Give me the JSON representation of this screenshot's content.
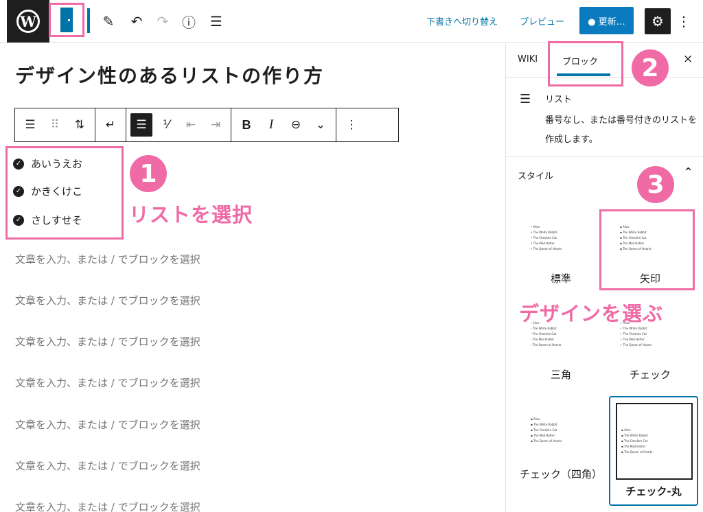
{
  "topbar": {
    "logo_glyph": "W",
    "icons": [
      "block-inserter-icon",
      "edit-pencil-icon",
      "undo-icon",
      "redo-icon",
      "info-icon",
      "list-view-icon"
    ],
    "switch_draft_label": "下書きへ切り替え",
    "preview_label": "プレビュー",
    "update_label": "● 更新…",
    "settings_glyph": "⚙",
    "more_glyph": "⋮"
  },
  "editor": {
    "title": "デザイン性のあるリストの作り方",
    "list_items": [
      "あいうえお",
      "かきくけこ",
      "さしすせそ"
    ],
    "paragraph_placeholder": "文章を入力、または / でブロックを選択",
    "paragraph_count": 7
  },
  "block_toolbar": {
    "glyphs": {
      "list_transform": "☰",
      "drag": "⠿",
      "mover": "⇅",
      "indent_back": "↵",
      "unordered": "☰",
      "ordered": "⅟",
      "outdent": "⇤",
      "indent": "⇥",
      "bold": "B",
      "italic": "I",
      "link": "⊖",
      "more_rich": "⌄",
      "options": "⋮"
    }
  },
  "annotations": {
    "step1": "1",
    "step1_text": "リストを選択",
    "step2": "2",
    "step3": "3",
    "step3_text": "デザインを選ぶ"
  },
  "sidebar": {
    "tab_wiki": "WIKI",
    "tab_block": "ブロック",
    "close_glyph": "×",
    "block_name": "リスト",
    "block_description": "番号なし、または番号付きのリストを作成します。",
    "styles_heading": "スタイル",
    "styles_chevron": "⌃",
    "styles": [
      {
        "label": "標準",
        "marker": "•"
      },
      {
        "label": "矢印",
        "marker": "▪"
      },
      {
        "label": "三角",
        "marker": "›"
      },
      {
        "label": "チェック",
        "marker": "✓"
      },
      {
        "label": "チェック（四角）",
        "marker": "▪"
      },
      {
        "label": "チェック-丸",
        "marker": "▪",
        "selected": true
      }
    ],
    "preview_items": [
      "Alice",
      "The White Rabbit",
      "The Cheshire Cat",
      "The Mad Hatter",
      "The Queen of Hearts"
    ]
  }
}
